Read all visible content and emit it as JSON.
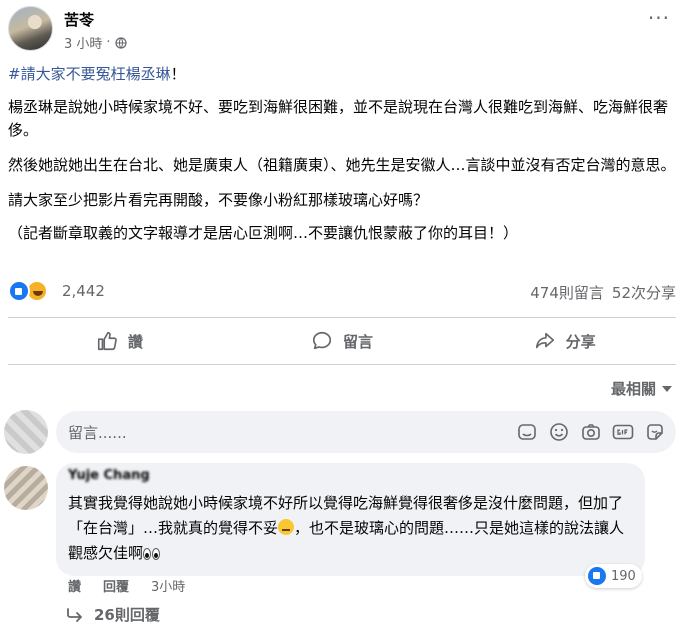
{
  "post": {
    "author": "苦苓",
    "time": "3 小時",
    "separator": "·",
    "more_label": "···",
    "hashtag": "#請大家不要冤枉楊丞琳",
    "hashtag_suffix": "！",
    "paragraphs": [
      "楊丞琳是說她小時候家境不好、要吃到海鮮很困難，並不是說現在台灣人很難吃到海鮮、吃海鮮很奢侈。",
      "然後她說她出生在台北、她是廣東人（祖籍廣東）、她先生是安徽人…言談中並沒有否定台灣的意思。",
      "請大家至少把影片看完再開酸，不要像小粉紅那樣玻璃心好嗎？",
      "（記者斷章取義的文字報導才是居心叵測啊…不要讓仇恨蒙蔽了你的耳目！）"
    ]
  },
  "reactions": {
    "count": "2,442",
    "icons": [
      "like-icon",
      "haha-icon"
    ],
    "comments_label": "474則留言",
    "shares_label": "52次分享"
  },
  "actions": {
    "like_label": "讚",
    "comment_label": "留言",
    "share_label": "分享"
  },
  "sort": {
    "label": "最相關"
  },
  "comment_box": {
    "placeholder": "留言......"
  },
  "comment": {
    "author": "Yuje Chang",
    "text_part1": "其實我覺得她說她小時候家境不好所以覺得吃海鮮覺得很奢侈是沒什麼問題，但加了「在台灣」…我就真的覺得不妥",
    "text_part2": "，也不是玻璃心的問題……只是她這樣的說法讓人觀感欠佳啊",
    "likes": "190",
    "like_label": "讚",
    "reply_label": "回覆",
    "time": "3小時",
    "replies_label": "26則回覆"
  },
  "colors": {
    "accent": "#1877f2",
    "hashtag": "#385898",
    "muted": "#65676b",
    "bubble": "#f0f2f5"
  }
}
